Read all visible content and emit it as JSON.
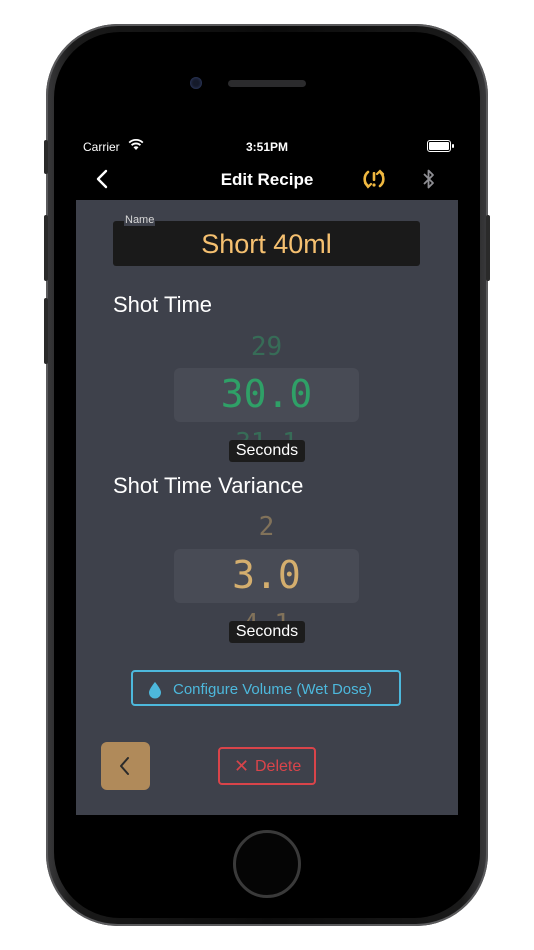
{
  "status_bar": {
    "carrier": "Carrier",
    "time": "3:51PM"
  },
  "nav": {
    "title": "Edit Recipe",
    "back_icon": "chevron-left-icon",
    "sync_icon": "sync-alert-icon",
    "bluetooth_icon": "bluetooth-icon"
  },
  "name_field": {
    "label": "Name",
    "value": "Short 40ml"
  },
  "shot_time": {
    "title": "Shot Time",
    "prev": "29",
    "current": "30.0",
    "next": "31.1",
    "unit": "Seconds"
  },
  "shot_time_variance": {
    "title": "Shot Time Variance",
    "prev": "2",
    "current": "3.0",
    "next": "4.1",
    "unit": "Seconds"
  },
  "configure_button": {
    "label": "Configure Volume (Wet Dose)",
    "icon": "water-drop-icon"
  },
  "delete_button": {
    "label": "Delete",
    "icon": "close-icon"
  },
  "colors": {
    "accent_gold": "#f5c070",
    "green": "#2fa067",
    "picker_gold": "#d4ae6e",
    "cyan": "#4db8dc",
    "red": "#d9444a",
    "back_button": "#b08a5a"
  }
}
